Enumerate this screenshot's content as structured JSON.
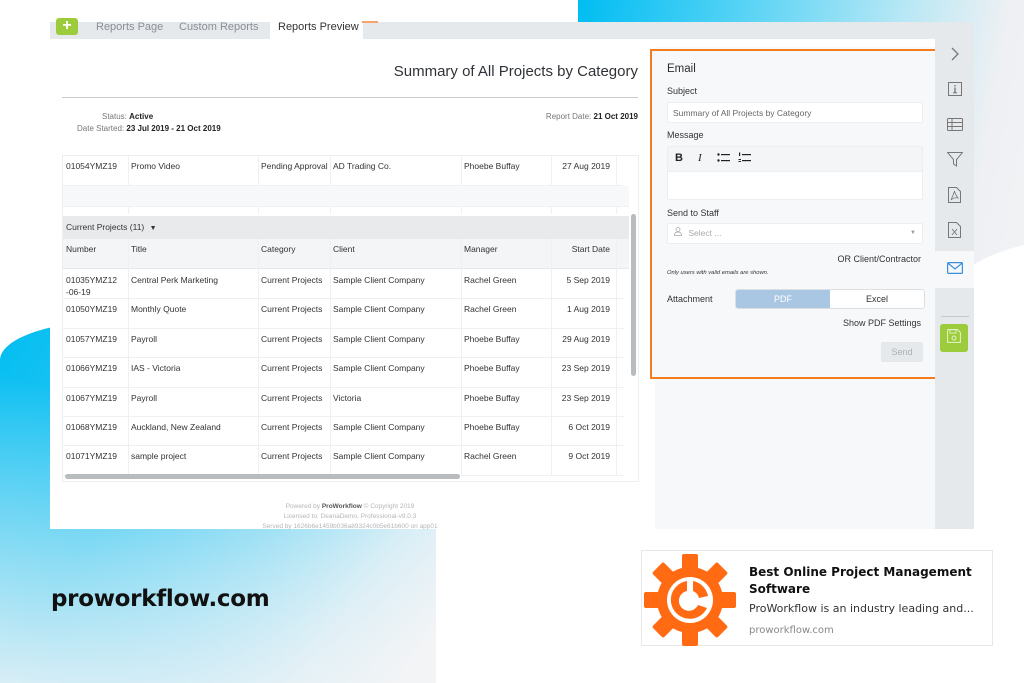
{
  "app": {
    "tabs": [
      {
        "label": "Reports Page",
        "active": false
      },
      {
        "label": "Custom Reports",
        "active": false
      },
      {
        "label": "Reports Preview",
        "active": true
      }
    ],
    "add_button_label": "+"
  },
  "report": {
    "title": "Summary of All Projects by Category",
    "status_label": "Status:",
    "status_value": "Active",
    "date_started_label": "Date Started:",
    "date_started_value": "23 Jul 2019 - 21 Oct 2019",
    "report_date_label": "Report Date:",
    "report_date_value": "21 Oct 2019"
  },
  "pending_rows": [
    {
      "number": "01054YMZ19",
      "title": "Promo Video",
      "category": "Pending Approval",
      "client": "AD Trading Co.",
      "manager": "Phoebe Buffay",
      "start_date": "27 Aug 2019"
    }
  ],
  "current_group": {
    "label": "Current Projects (11)",
    "columns": [
      "Number",
      "Title",
      "Category",
      "Client",
      "Manager",
      "Start Date"
    ],
    "rows": [
      {
        "number": "01035YMZ12 -06-19",
        "title": "Central Perk Marketing",
        "category": "Current Projects",
        "client": "Sample Client Company",
        "manager": "Rachel Green",
        "start_date": "5 Sep 2019"
      },
      {
        "number": "01050YMZ19",
        "title": "Monthly Quote",
        "category": "Current Projects",
        "client": "Sample Client Company",
        "manager": "Rachel Green",
        "start_date": "1 Aug 2019"
      },
      {
        "number": "01057YMZ19",
        "title": "Payroll",
        "category": "Current Projects",
        "client": "Sample Client Company",
        "manager": "Phoebe Buffay",
        "start_date": "29 Aug 2019"
      },
      {
        "number": "01066YMZ19",
        "title": "IAS - Victoria",
        "category": "Current Projects",
        "client": "Sample Client Company",
        "manager": "Phoebe Buffay",
        "start_date": "23 Sep 2019"
      },
      {
        "number": "01067YMZ19",
        "title": "Payroll",
        "category": "Current Projects",
        "client": "Victoria",
        "manager": "Phoebe Buffay",
        "start_date": "23 Sep 2019"
      },
      {
        "number": "01068YMZ19",
        "title": "Auckland, New Zealand",
        "category": "Current Projects",
        "client": "Sample Client Company",
        "manager": "Phoebe Buffay",
        "start_date": "6 Oct 2019"
      },
      {
        "number": "01071YMZ19",
        "title": "sample project",
        "category": "Current Projects",
        "client": "Sample Client Company",
        "manager": "Rachel Green",
        "start_date": "9 Oct 2019"
      }
    ]
  },
  "footer": {
    "powered_prefix": "Powered by",
    "brand": "ProWorkflow",
    "powered_suffix": "© Copyright 2019",
    "licensed": "Licensed to: DeanaDemo, Professional-v9.0.3",
    "served": "Served by 1626b6e1459b036a89324c0b5e61b600 on app01"
  },
  "email": {
    "title": "Email",
    "subject_label": "Subject",
    "subject_value": "Summary of All Projects by Category",
    "message_label": "Message",
    "toolbar": {
      "bold": "B",
      "italic": "I",
      "bullet_list": "⁝☰",
      "numbered_list": "⁝☰"
    },
    "send_to_staff_label": "Send to Staff",
    "staff_placeholder": "Select ...",
    "or_client_label": "OR Client/Contractor",
    "valid_note": "Only users with valid emails are shown.",
    "attachment_label": "Attachment",
    "attachment_options": [
      "PDF",
      "Excel"
    ],
    "attachment_selected": "PDF",
    "show_pdf_settings": "Show PDF Settings",
    "send_label": "Send",
    "accent_color": "#f47b20"
  },
  "rail": {
    "items": [
      "collapse-chevron",
      "info",
      "table",
      "filter",
      "pdf-export",
      "excel-export",
      "email"
    ],
    "active": "email",
    "save_color": "#9ccc3c"
  },
  "site_text": "proworkflow.com",
  "link_card": {
    "title": "Best Online Project Management Software",
    "description": "ProWorkflow is an industry leading and...",
    "url": "proworkflow.com",
    "logo_color": "#ff6a13"
  }
}
